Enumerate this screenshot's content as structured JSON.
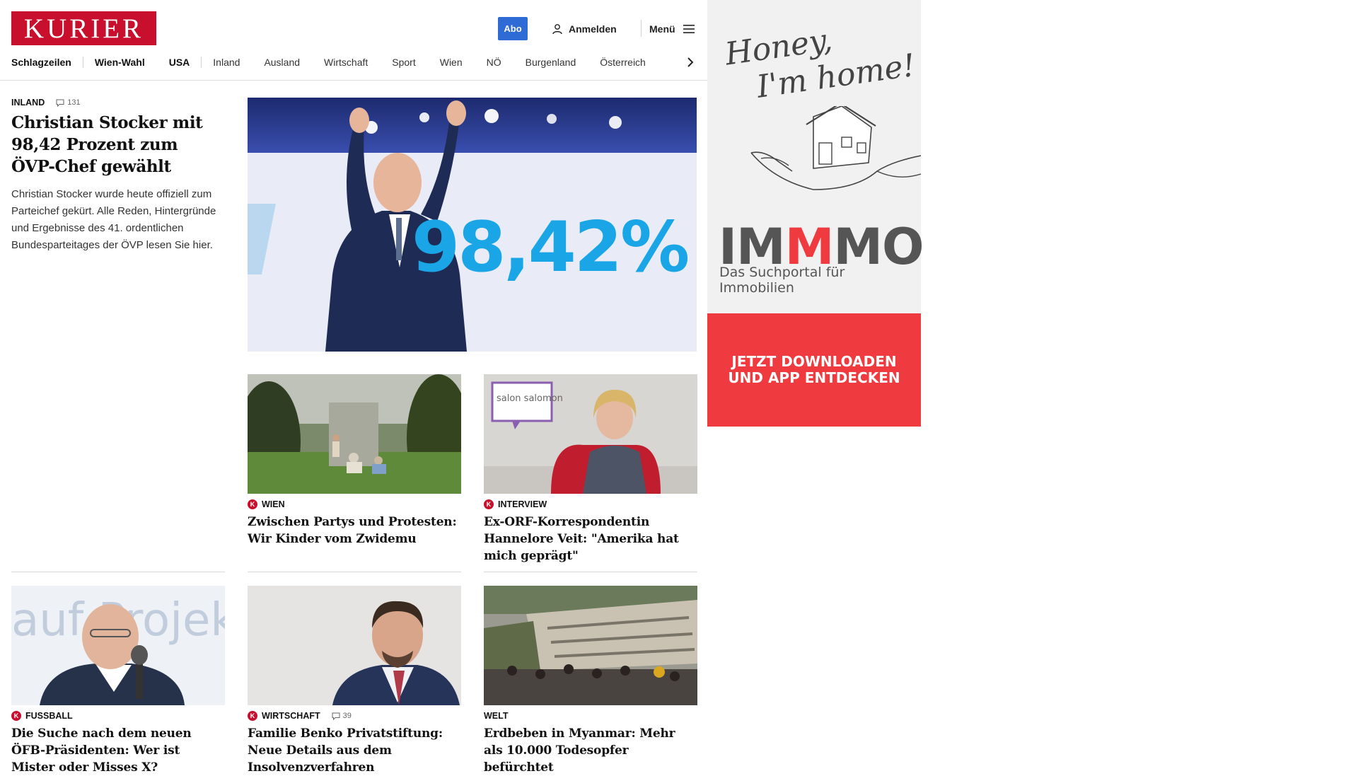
{
  "header": {
    "logo_text": "KURIER",
    "abo_label": "Abo",
    "login_label": "Anmelden",
    "menu_label": "Menü"
  },
  "nav": {
    "items": [
      "Schlagzeilen",
      "Wien-Wahl",
      "USA",
      "Inland",
      "Ausland",
      "Wirtschaft",
      "Sport",
      "Wien",
      "NÖ",
      "Burgenland",
      "Österreich"
    ]
  },
  "lead": {
    "kicker": "INLAND",
    "comments": "131",
    "headline": "Christian Stocker mit 98,42 Prozent zum ÖVP-Chef gewählt",
    "teaser": "Christian Stocker wurde heute offiziell zum Parteichef gekürt. Alle Reden, Hintergründe und Ergebnisse des 41. ordentlichen Bundesparteitages der ÖVP lesen Sie hier.",
    "image_text": "98,42%"
  },
  "cards": [
    {
      "kicker": "WIEN",
      "headline": "Zwischen Partys und Protesten: Wir Kinder vom Zwidemu"
    },
    {
      "kicker": "INTERVIEW",
      "headline": "Ex-ORF-Korrespondentin Hannelore Veit: \"Amerika hat mich geprägt\"",
      "image_badge": "salon salomon"
    },
    {
      "kicker": "FUSSBALL",
      "headline": "Die Suche nach dem neuen ÖFB-Präsidenten: Wer ist Mister oder Misses X?",
      "image_bg_text": "auf Projek"
    },
    {
      "kicker": "WIRTSCHAFT",
      "comments": "39",
      "headline": "Familie Benko Privatstiftung: Neue Details aus dem Insolvenzverfahren"
    },
    {
      "kicker": "WELT",
      "headline": "Erdbeben in Myanmar: Mehr als 10.000 Todesopfer befürchtet"
    }
  ],
  "ad": {
    "script_line1": "Honey,",
    "script_line2": "I'm home!",
    "brand_a": "IM",
    "brand_m": "M",
    "brand_b": "MO",
    "subline": "Das Suchportal für Immobilien",
    "cta_line1": "JETZT DOWNLOADEN",
    "cta_line2": "UND APP ENTDECKEN"
  },
  "colors": {
    "brand_red": "#c8102e",
    "abo_blue": "#2f6bd4",
    "ad_red": "#ef3a3f",
    "percent_blue": "#1aa6e6"
  }
}
